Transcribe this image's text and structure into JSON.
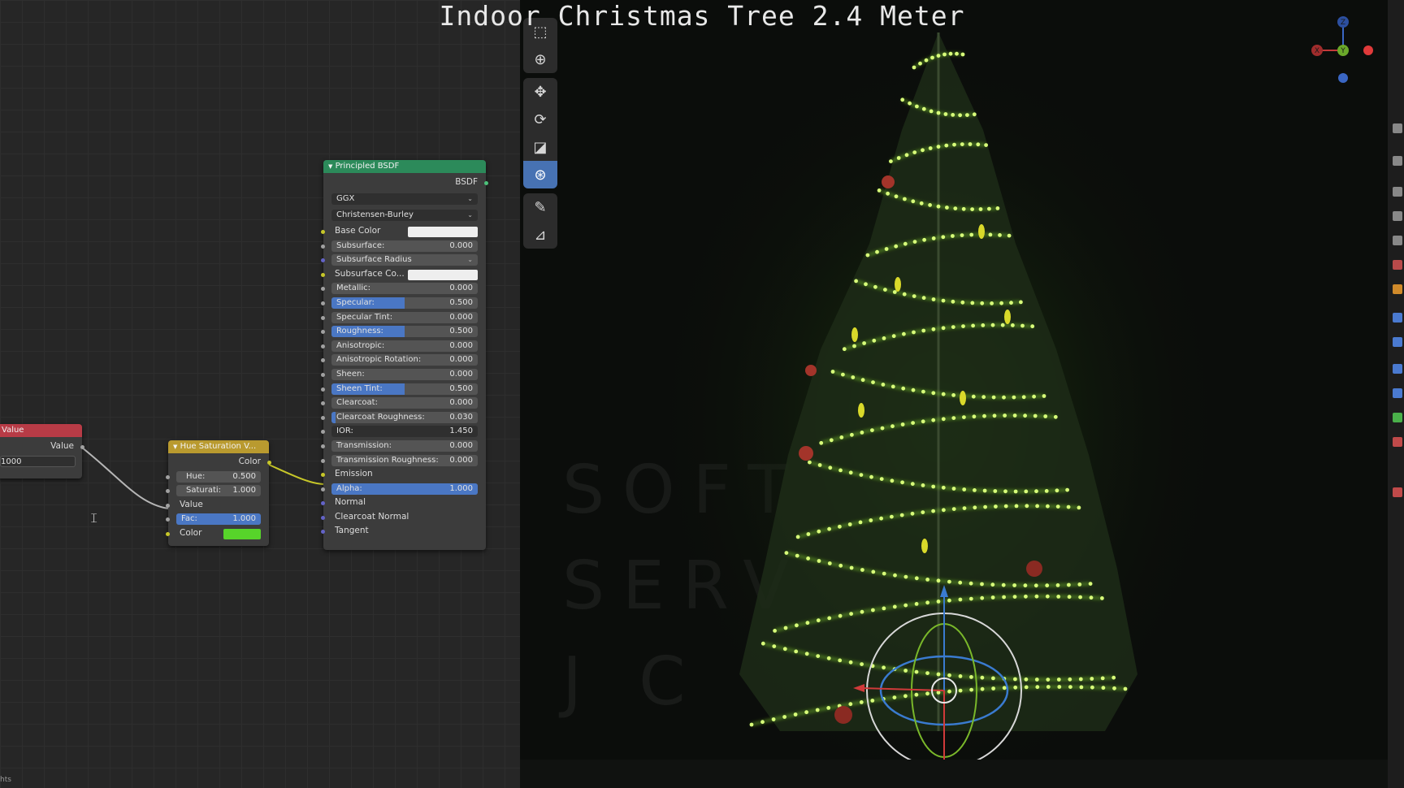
{
  "overlay_title": "Indoor Christmas Tree 2.4 Meter",
  "status_left": "hts",
  "watermark": {
    "line1": "SOFT",
    "line2": "SERV",
    "line3": "J C"
  },
  "nodes": {
    "value_node": {
      "title": "Value",
      "output_label": "Value",
      "input_value": "1000"
    },
    "hue_sat_node": {
      "title": "Hue Saturation V...",
      "output_label": "Color",
      "hue_label": "Hue:",
      "hue_value": "0.500",
      "saturation_label": "Saturati:",
      "saturation_value": "1.000",
      "value_label": "Value",
      "fac_label": "Fac:",
      "fac_value": "1.000",
      "color_label": "Color",
      "color_swatch": "#57d42a"
    },
    "bsdf_node": {
      "title": "Principled BSDF",
      "output_label": "BSDF",
      "distribution": "GGX",
      "subsurface_method": "Christensen-Burley",
      "base_color_label": "Base Color",
      "subsurface_radius_label": "Subsurface Radius",
      "subsurface_color_label": "Subsurface Co...",
      "emission_label": "Emission",
      "normal_label": "Normal",
      "clearcoat_normal_label": "Clearcoat Normal",
      "tangent_label": "Tangent",
      "sliders": [
        {
          "label": "Subsurface:",
          "value": "0.000",
          "fill": 0
        },
        {
          "label": "Metallic:",
          "value": "0.000",
          "fill": 0
        },
        {
          "label": "Specular:",
          "value": "0.500",
          "fill": 0.5
        },
        {
          "label": "Specular Tint:",
          "value": "0.000",
          "fill": 0
        },
        {
          "label": "Roughness:",
          "value": "0.500",
          "fill": 0.5
        },
        {
          "label": "Anisotropic:",
          "value": "0.000",
          "fill": 0
        },
        {
          "label": "Anisotropic Rotation:",
          "value": "0.000",
          "fill": 0
        },
        {
          "label": "Sheen:",
          "value": "0.000",
          "fill": 0
        },
        {
          "label": "Sheen Tint:",
          "value": "0.500",
          "fill": 0.5
        },
        {
          "label": "Clearcoat:",
          "value": "0.000",
          "fill": 0
        },
        {
          "label": "Clearcoat Roughness:",
          "value": "0.030",
          "fill": 0.03
        },
        {
          "label": "IOR:",
          "value": "1.450",
          "fill": 0
        },
        {
          "label": "Transmission:",
          "value": "0.000",
          "fill": 0
        },
        {
          "label": "Transmission Roughness:",
          "value": "0.000",
          "fill": 0
        },
        {
          "label": "Alpha:",
          "value": "1.000",
          "fill": 1
        }
      ]
    }
  },
  "toolbar": {
    "tools": [
      "select-box-icon",
      "cursor-icon",
      "move-icon",
      "rotate-icon",
      "scale-icon",
      "transform-icon",
      "annotate-icon",
      "measure-icon"
    ],
    "active_tool": "transform-icon"
  },
  "gizmo": {
    "x_label": "X",
    "y_label": "Y",
    "z_label": "Z"
  },
  "colors": {
    "value_header": "#b83b46",
    "hue_header": "#b99a2f",
    "bsdf_header": "#2c8a5a",
    "active_tool": "#4772b3",
    "light_green": "#9cff2e"
  }
}
